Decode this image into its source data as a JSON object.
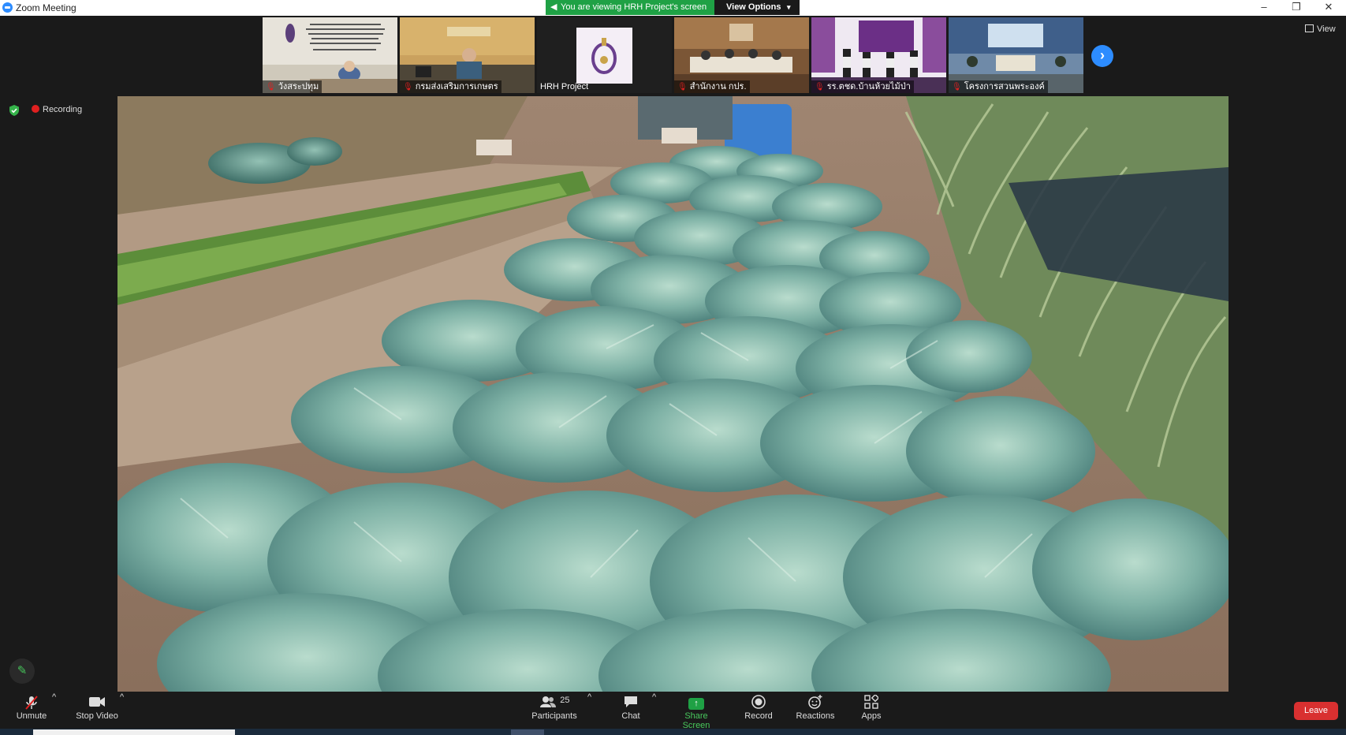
{
  "window": {
    "title": "Zoom Meeting"
  },
  "share_banner": {
    "text": "You are viewing HRH Project's screen",
    "view_options": "View Options"
  },
  "thumbnails": [
    {
      "name": "วังสระปทุม",
      "muted": true
    },
    {
      "name": "กรมส่งเสริมการเกษตร",
      "muted": true
    },
    {
      "name": "HRH Project",
      "muted": false
    },
    {
      "name": "สำนักงาน กปร.",
      "muted": true
    },
    {
      "name": "รร.ตชด.บ้านห้วยไม้ป่า",
      "muted": true
    },
    {
      "name": "โครงการสวนพระองค์",
      "muted": true
    }
  ],
  "view_button": {
    "label": "View"
  },
  "status": {
    "recording": "Recording"
  },
  "toolbar": {
    "unmute": "Unmute",
    "stop_video": "Stop Video",
    "participants": "Participants",
    "participants_count": "25",
    "chat": "Chat",
    "share_screen": "Share Screen",
    "record": "Record",
    "reactions": "Reactions",
    "apps": "Apps",
    "leave": "Leave"
  },
  "colors": {
    "share_green": "#1fa145",
    "leave_red": "#d93030",
    "accent_blue": "#2d8cff"
  }
}
